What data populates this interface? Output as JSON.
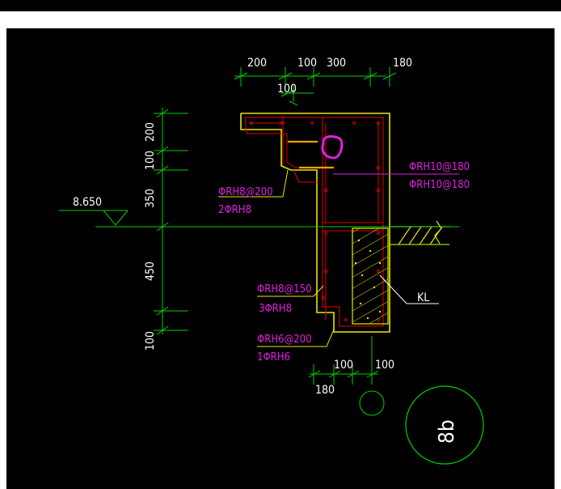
{
  "colors": {
    "background": "#000000",
    "frame": "#ffffff",
    "green": "#00d000",
    "white": "#ffffff",
    "yellow": "#e8e800",
    "red": "#e00000",
    "magenta": "#e020e0",
    "orange": "#ffa000"
  },
  "dimensions": {
    "top": [
      "200",
      "100",
      "300",
      "180"
    ],
    "top_second_row": "100",
    "left": [
      "200",
      "100",
      "350",
      "450",
      "100"
    ],
    "bottom": [
      "100",
      "100"
    ],
    "bottom_second_row": "180"
  },
  "elevation": "8.650",
  "rebar_labels": {
    "upper_left_1": "ΦRH8@200",
    "upper_left_2": "2ΦRH8",
    "right_1": "ΦRH10@180",
    "right_2": "ΦRH10@180",
    "lower_1": "ΦRH8@150",
    "lower_2": "3ΦRH8",
    "bottom_1": "ΦRH6@200",
    "bottom_2": "1ΦRH6"
  },
  "beam_label": "KL",
  "detail_number": "8b"
}
